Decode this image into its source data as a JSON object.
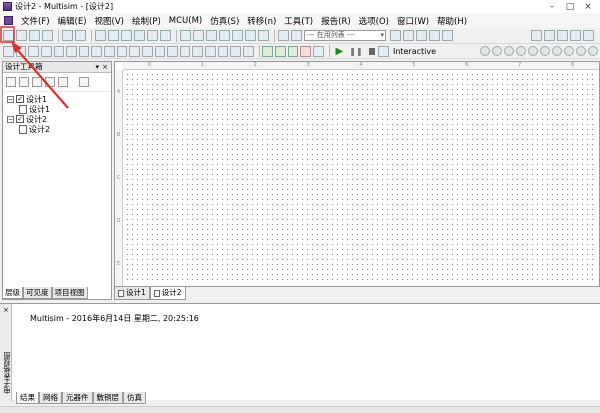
{
  "window": {
    "title": "设计2 - Multisim - [设计2]"
  },
  "menu": [
    "文件(F)",
    "编辑(E)",
    "视图(V)",
    "绘制(P)",
    "MCU(M)",
    "仿真(S)",
    "转移(n)",
    "工具(T)",
    "报告(R)",
    "选项(O)",
    "窗口(W)",
    "帮助(H)"
  ],
  "toolbar": {
    "combo_value": "--- 在用列表 ---",
    "interactive_label": "Interactive"
  },
  "design_panel": {
    "title": "设计工具箱",
    "tree": [
      {
        "label": "设计1",
        "child": "设计1"
      },
      {
        "label": "设计2",
        "child": "设计2"
      }
    ],
    "tabs": [
      "层级",
      "可见度",
      "项目视图"
    ]
  },
  "sheet_tabs": [
    "设计1",
    "设计2"
  ],
  "output": {
    "strip_label": "电子表格视图",
    "log": "Multisim  -  2016年6月14日 星期二, 20:25:16",
    "tabs": [
      "结果",
      "网络",
      "元器件",
      "敷铜层",
      "仿真"
    ]
  },
  "colors": {
    "annotation_arrow": "#d93030"
  }
}
